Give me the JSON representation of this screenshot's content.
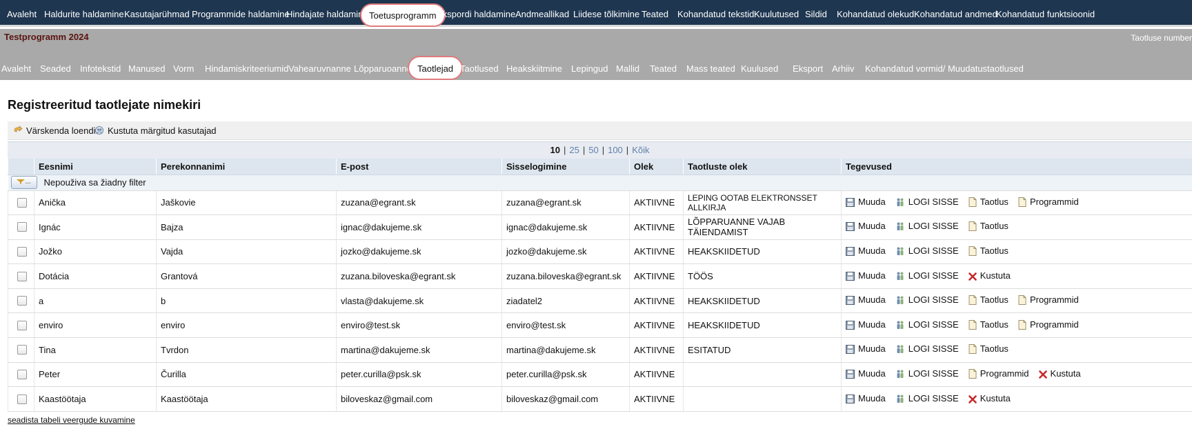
{
  "top_nav": {
    "items": [
      "Avaleht",
      "Haldurite haldamine",
      "Kasutajarühmad",
      "Programmide haldamine",
      "Hindajate haldamine",
      "Toetusprogramm",
      "Ekspordi haldamine",
      "Andmeallikad",
      "Liidese tõlkimine",
      "Teated",
      "Kohandatud tekstid",
      "Kuulutused",
      "Sildid",
      "Kohandatud olekud",
      "Kohandatud andmed",
      "Kohandatud funktsioonid"
    ],
    "active": "Toetusprogramm"
  },
  "program_header": {
    "title": "Testprogramm 2024",
    "right_text": "Taotluse number"
  },
  "sub_nav": {
    "items": [
      "Avaleht",
      "Seaded",
      "Infotekstid",
      "Manused",
      "Vorm",
      "Hindamiskriteeriumid",
      "Vahearuvnanne",
      "Lõpparuoanne",
      "Taotlejad",
      "Taotlused",
      "Heakskiitmine",
      "Lepingud",
      "Mallid",
      "Teated",
      "Mass teated",
      "Kuulused",
      "Eksport",
      "Arhiiv",
      "Kohandatud vormid/ Muudatustaotlused"
    ],
    "active": "Taotlejad"
  },
  "page": {
    "title": "Registreeritud taotlejate nimekiri"
  },
  "toolbar": {
    "refresh_label": "Värskenda loendit",
    "delete_label": "Kustuta märgitud kasutajad"
  },
  "pager": {
    "sizes": [
      "10",
      "25",
      "50",
      "100",
      "Kõik"
    ],
    "current": "10"
  },
  "table": {
    "columns": [
      "Eesnimi",
      "Perekonnanimi",
      "E-post",
      "Sisselogimine",
      "Olek",
      "Taotluste olek",
      "Tegevused"
    ],
    "filter_label": "Nepouživa sa žiadny filter",
    "filter_button": "...",
    "rows": [
      {
        "first": "Anička",
        "last": "Jaškovie",
        "email": "zuzana@egrant.sk",
        "login": "zuzana@egrant.sk",
        "status": "AKTIIVNE",
        "app_status": "LEPING OOTAB ELEKTRONSSET ALLKIRJA",
        "actions": [
          "Muuda",
          "LOGI SISSE",
          "Taotlus",
          "Programmid"
        ]
      },
      {
        "first": "Ignác",
        "last": "Bajza",
        "email": "ignac@dakujeme.sk",
        "login": "ignac@dakujeme.sk",
        "status": "AKTIIVNE",
        "app_status": "LÕPPARUANNE VAJAB TÄIENDAMIST",
        "actions": [
          "Muuda",
          "LOGI SISSE",
          "Taotlus"
        ]
      },
      {
        "first": "Jožko",
        "last": "Vajda",
        "email": "jozko@dakujeme.sk",
        "login": "jozko@dakujeme.sk",
        "status": "AKTIIVNE",
        "app_status": "HEAKSKIIDETUD",
        "actions": [
          "Muuda",
          "LOGI SISSE",
          "Taotlus"
        ]
      },
      {
        "first": "Dotácia",
        "last": "Grantová",
        "email": "zuzana.biloveska@egrant.sk",
        "login": "zuzana.biloveska@egrant.sk",
        "status": "AKTIIVNE",
        "app_status": "TÖÖS",
        "actions": [
          "Muuda",
          "LOGI SISSE",
          "Kustuta"
        ]
      },
      {
        "first": "a",
        "last": "b",
        "email": "vlasta@dakujeme.sk",
        "login": "ziadatel2",
        "status": "AKTIIVNE",
        "app_status": "HEAKSKIIDETUD",
        "actions": [
          "Muuda",
          "LOGI SISSE",
          "Taotlus",
          "Programmid"
        ]
      },
      {
        "first": "enviro",
        "last": "enviro",
        "email": "enviro@test.sk",
        "login": "enviro@test.sk",
        "status": "AKTIIVNE",
        "app_status": "HEAKSKIIDETUD",
        "actions": [
          "Muuda",
          "LOGI SISSE",
          "Taotlus",
          "Programmid"
        ]
      },
      {
        "first": "Tina",
        "last": "Tvrdon",
        "email": "martina@dakujeme.sk",
        "login": "martina@dakujeme.sk",
        "status": "AKTIIVNE",
        "app_status": "ESITATUD",
        "actions": [
          "Muuda",
          "LOGI SISSE",
          "Taotlus"
        ]
      },
      {
        "first": "Peter",
        "last": "Čurilla",
        "email": "peter.curilla@psk.sk",
        "login": "peter.curilla@psk.sk",
        "status": "AKTIIVNE",
        "app_status": "",
        "actions": [
          "Muuda",
          "LOGI SISSE",
          "Programmid",
          "Kustuta"
        ]
      },
      {
        "first": "Kaastöötaja",
        "last": "Kaastöötaja",
        "email": "biloveskaz@gmail.com",
        "login": "biloveskaz@gmail.com",
        "status": "AKTIIVNE",
        "app_status": "",
        "actions": [
          "Muuda",
          "LOGI SISSE",
          "Kustuta"
        ]
      }
    ]
  },
  "footer": {
    "configure_columns_link": "seadista tabeli veergude kuvamine"
  },
  "colors": {
    "top_nav_bg": "#1f3650",
    "sub_nav_bg": "#a9a9a9",
    "program_title": "#5a1410",
    "active_ring": "#e07a7a",
    "delete_red": "#c62828",
    "pager_link": "#5f7fa8"
  },
  "icons": {
    "Muuda": "save-icon",
    "LOGI SISSE": "users-icon",
    "Taotlus": "document-icon",
    "Programmid": "document-icon",
    "Kustuta": "delete-x-icon",
    "refresh": "refresh-arrow-icon",
    "delete_selected": "delete-users-icon",
    "filter": "filter-icon"
  }
}
